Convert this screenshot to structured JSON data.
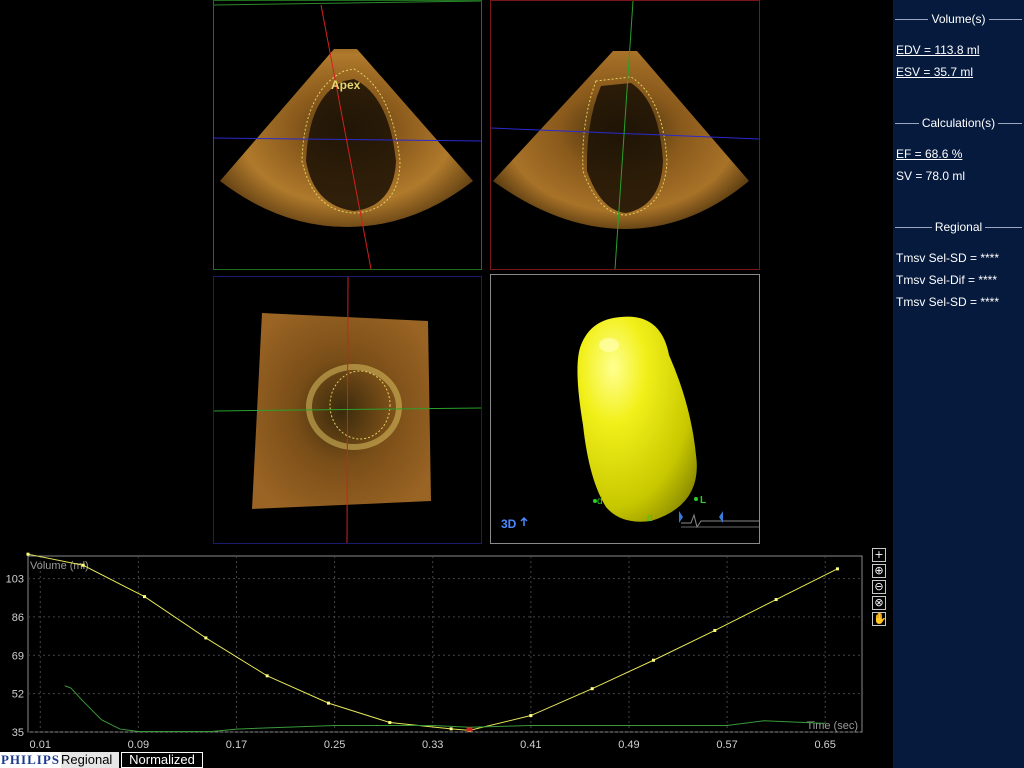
{
  "views": {
    "four_chamber": {
      "label": "Apex"
    },
    "model_3d": {
      "label": "3D",
      "marker_left": "d",
      "marker_right": "L",
      "marker_bottom": "d"
    }
  },
  "side_panel": {
    "volumes": {
      "title": "Volume(s)",
      "edv": "EDV = 113.8 ml",
      "esv": "ESV = 35.7 ml"
    },
    "calculations": {
      "title": "Calculation(s)",
      "ef": "EF = 68.6 %",
      "sv": "SV = 78.0 ml"
    },
    "regional": {
      "title": "Regional",
      "items": [
        "Tmsv Sel-SD = ****",
        "Tmsv Sel-Dif = ****",
        "Tmsv Sel-SD = ****"
      ]
    }
  },
  "graph": {
    "toolbar": [
      {
        "name": "pan-cross-icon",
        "glyph": "+"
      },
      {
        "name": "zoom-in-icon",
        "glyph": "⊕"
      },
      {
        "name": "zoom-out-icon",
        "glyph": "⊖"
      },
      {
        "name": "reset-zoom-icon",
        "glyph": "⊗"
      },
      {
        "name": "hand-icon",
        "glyph": "✋"
      }
    ]
  },
  "status_bar": {
    "logo": "PHILIPS",
    "tab_regional": "Regional",
    "tab_normalized": "Normalized"
  },
  "colors": {
    "volume_curve": "#e6e65a",
    "regional_curve": "#3a9a3a",
    "panel_bg": "#061a3e"
  },
  "chart_data": {
    "type": "line",
    "ylabel": "Volume (ml)",
    "xlabel": "Time (sec)",
    "x_ticks": [
      0.01,
      0.09,
      0.17,
      0.25,
      0.33,
      0.41,
      0.49,
      0.57,
      0.65
    ],
    "y_ticks": [
      35,
      52,
      69,
      86,
      103
    ],
    "xlim": [
      0.0,
      0.68
    ],
    "ylim": [
      35,
      113
    ],
    "grid": true,
    "series": [
      {
        "x": [
          0.0,
          0.045,
          0.095,
          0.145,
          0.195,
          0.245,
          0.295,
          0.345,
          0.36,
          0.41,
          0.46,
          0.51,
          0.56,
          0.61,
          0.66
        ],
        "values": [
          113.8,
          108.9,
          95.0,
          76.7,
          59.9,
          47.8,
          39.2,
          36.4,
          35.7,
          42.3,
          54.2,
          66.8,
          80.0,
          93.7,
          107.3
        ]
      },
      {
        "x": [
          0.03,
          0.035,
          0.045,
          0.06,
          0.075,
          0.09,
          0.15,
          0.17,
          0.21,
          0.25,
          0.33,
          0.36,
          0.41,
          0.57,
          0.6,
          0.65
        ],
        "values": [
          55.5,
          54.5,
          48.6,
          40.4,
          36.3,
          35.2,
          35.2,
          36.3,
          37.1,
          37.9,
          37.9,
          37.1,
          37.9,
          37.9,
          40.0,
          38.8
        ]
      }
    ]
  }
}
